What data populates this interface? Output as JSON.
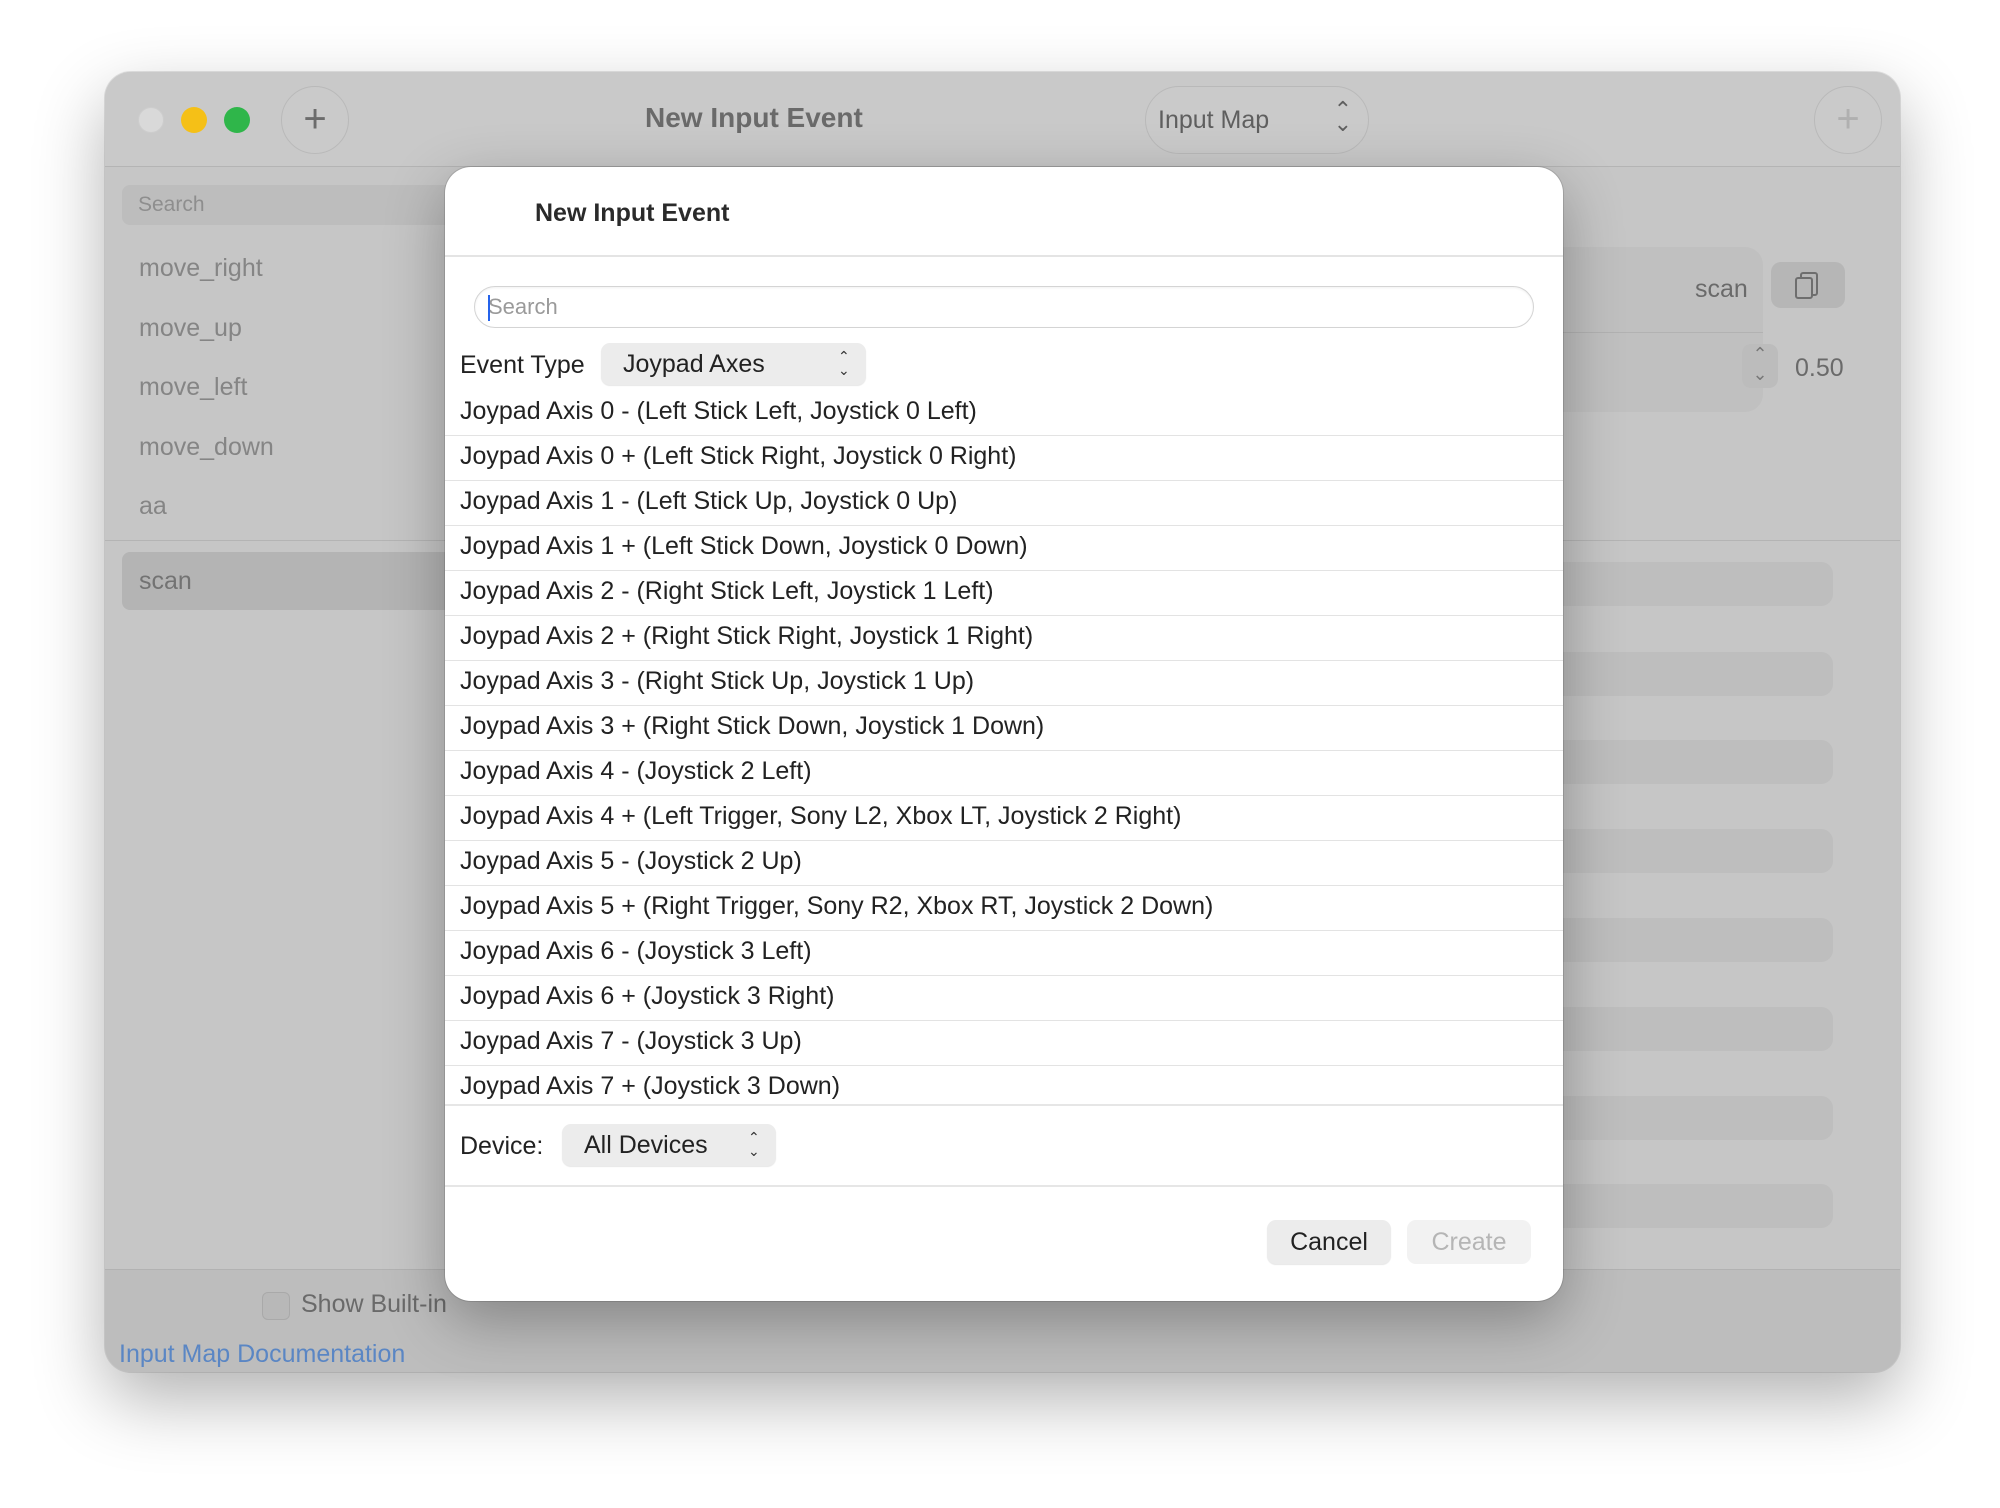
{
  "window": {
    "title": "New Input Event",
    "mode_select": "Input Map",
    "add_symbol": "+"
  },
  "sidebar": {
    "search_placeholder": "Search",
    "items": [
      "move_right",
      "move_up",
      "move_left",
      "move_down",
      "aa",
      "scan"
    ],
    "selected": "scan"
  },
  "detail": {
    "action_name": "scan",
    "deadzone": "0.50"
  },
  "bottom": {
    "show_builtin": "Show Built-in",
    "doc_link": "Input Map Documentation"
  },
  "dialog": {
    "title": "New Input Event",
    "search_placeholder": "Search",
    "event_type_label": "Event Type",
    "event_type_value": "Joypad Axes",
    "events": [
      "Joypad Axis 0 - (Left Stick Left, Joystick 0 Left)",
      "Joypad Axis 0 + (Left Stick Right, Joystick 0 Right)",
      "Joypad Axis 1 - (Left Stick Up, Joystick 0 Up)",
      "Joypad Axis 1 + (Left Stick Down, Joystick 0 Down)",
      "Joypad Axis 2 - (Right Stick Left, Joystick 1 Left)",
      "Joypad Axis 2 + (Right Stick Right, Joystick 1 Right)",
      "Joypad Axis 3 - (Right Stick Up, Joystick 1 Up)",
      "Joypad Axis 3 + (Right Stick Down, Joystick 1 Down)",
      "Joypad Axis 4 - (Joystick 2 Left)",
      "Joypad Axis 4 + (Left Trigger, Sony L2, Xbox LT, Joystick 2 Right)",
      "Joypad Axis 5 - (Joystick 2 Up)",
      "Joypad Axis 5 + (Right Trigger, Sony R2, Xbox RT, Joystick 2 Down)",
      "Joypad Axis 6 - (Joystick 3 Left)",
      "Joypad Axis 6 + (Joystick 3 Right)",
      "Joypad Axis 7 - (Joystick 3 Up)",
      "Joypad Axis 7 + (Joystick 3 Down)"
    ],
    "device_label": "Device:",
    "device_value": "All Devices",
    "cancel_label": "Cancel",
    "create_label": "Create"
  },
  "icons": {
    "popup_chevrons": "⌃⌄",
    "stepper": "chevron-up-down-icon",
    "copy": "copy-icon"
  },
  "colors": {
    "traffic_close": "#d9d9d9",
    "traffic_min": "#f5c017",
    "traffic_max": "#2fb64a",
    "link": "#5a86c4",
    "caret": "#2563eb"
  }
}
